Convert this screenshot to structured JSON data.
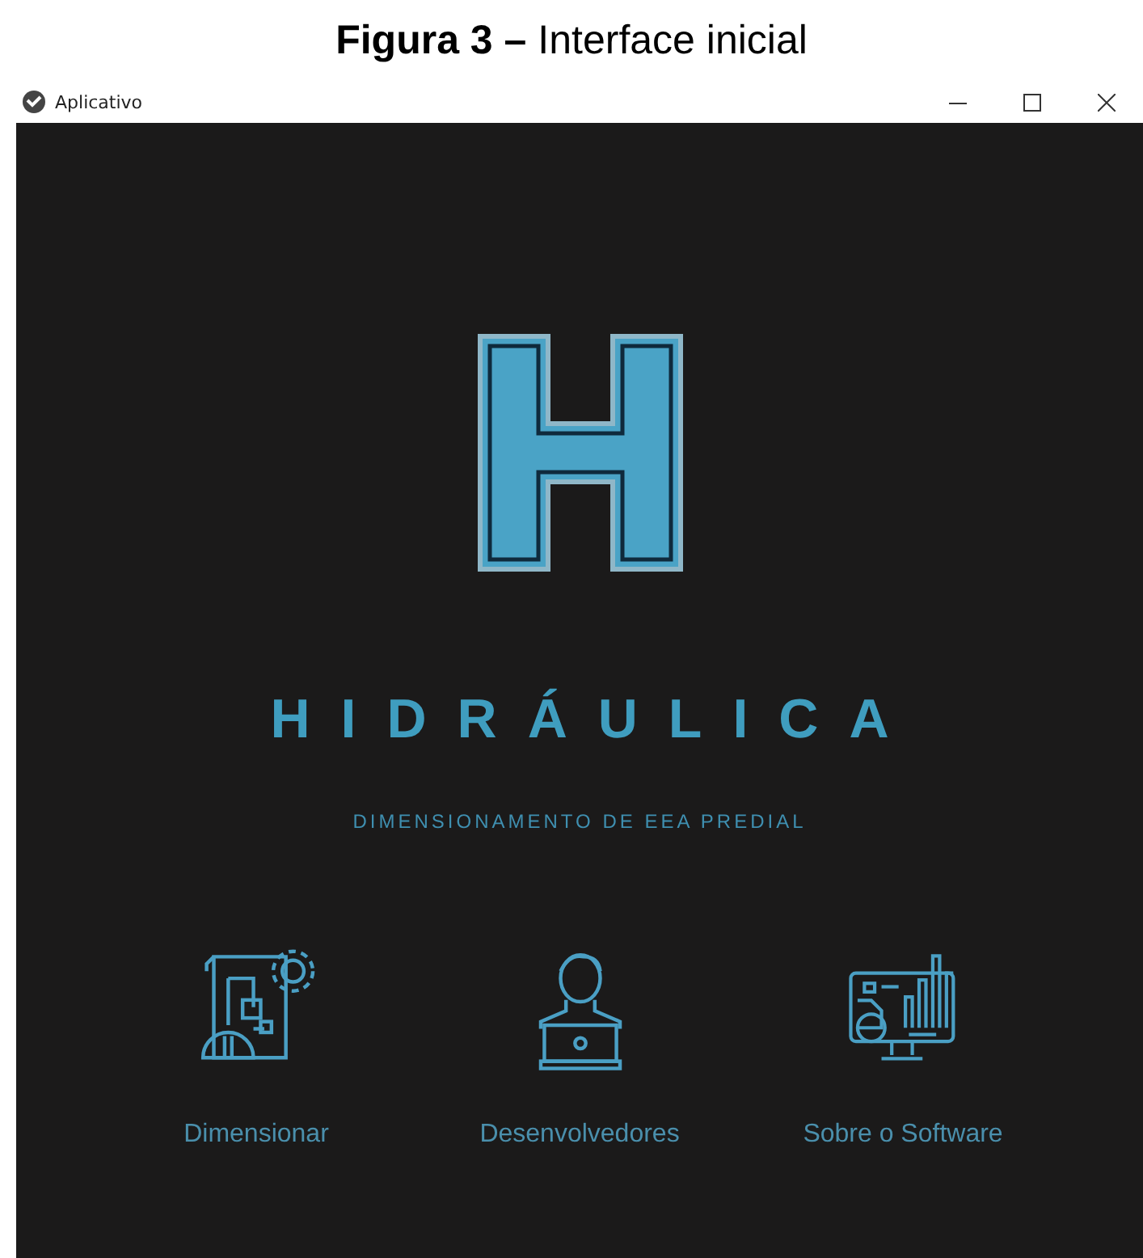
{
  "caption": {
    "number": "Figura 3 –",
    "title": "Interface inicial"
  },
  "window": {
    "title": "Aplicativo"
  },
  "app": {
    "title": "HIDRÁULICA",
    "subtitle": "DIMENSIONAMENTO DE EEA PREDIAL"
  },
  "menu": [
    {
      "kind": "blueprint",
      "label": "Dimensionar"
    },
    {
      "kind": "developer",
      "label": "Desenvolvedores"
    },
    {
      "kind": "monitor",
      "label": "Sobre o Software"
    }
  ]
}
